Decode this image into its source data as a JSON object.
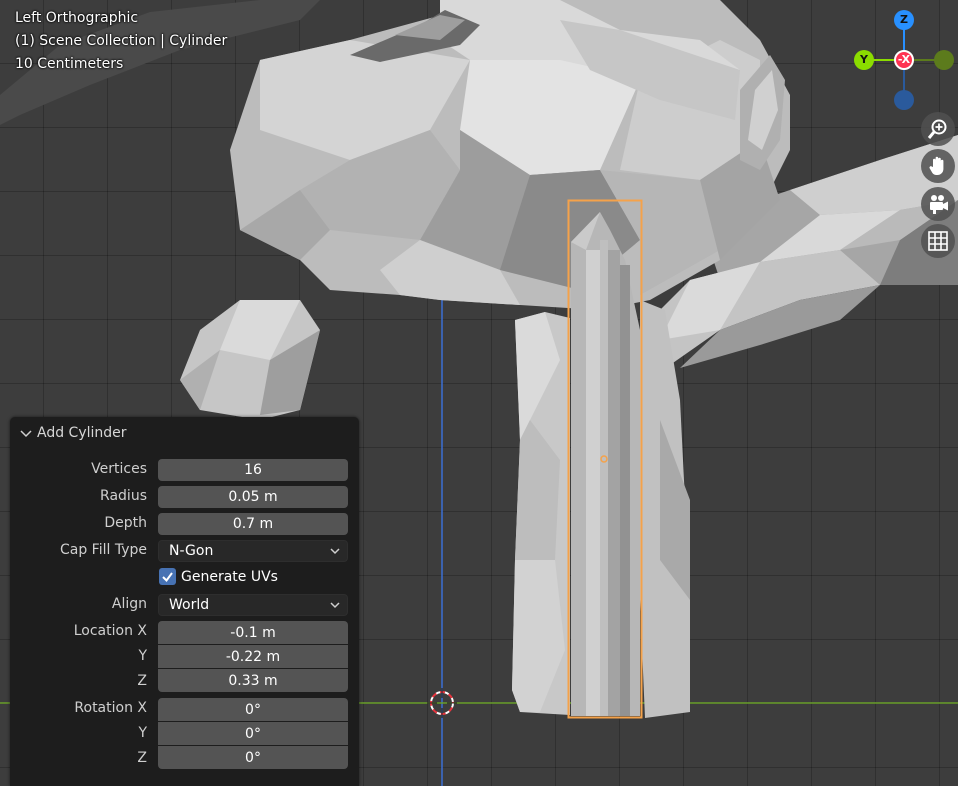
{
  "viewport": {
    "view_name": "Left Orthographic",
    "collection_info": "(1) Scene Collection | Cylinder",
    "scale_info": "10 Centimeters"
  },
  "gizmo": {
    "axis_z": "Z",
    "axis_y": "Y",
    "axis_x": "-X",
    "colors": {
      "x": "#ff3352",
      "y": "#8bdc00",
      "z": "#2890ff",
      "neg_y": "#5c7b1c",
      "neg_z": "#2a5a9c"
    }
  },
  "nav_buttons": [
    "zoom-icon",
    "hand-pan-icon",
    "camera-icon",
    "grid-icon"
  ],
  "operator_panel": {
    "title": "Add Cylinder",
    "vertices_label": "Vertices",
    "vertices_value": "16",
    "radius_label": "Radius",
    "radius_value": "0.05 m",
    "depth_label": "Depth",
    "depth_value": "0.7 m",
    "cap_fill_label": "Cap Fill Type",
    "cap_fill_value": "N-Gon",
    "generate_uvs_label": "Generate UVs",
    "generate_uvs_checked": true,
    "align_label": "Align",
    "align_value": "World",
    "location_label": "Location X",
    "location_y_label": "Y",
    "location_z_label": "Z",
    "location_x": "-0.1 m",
    "location_y": "-0.22 m",
    "location_z": "0.33 m",
    "rotation_label": "Rotation X",
    "rotation_y_label": "Y",
    "rotation_z_label": "Z",
    "rotation_x": "0°",
    "rotation_y": "0°",
    "rotation_z": "0°"
  },
  "colors": {
    "selection_outline": "#f5a24a",
    "checkbox_accent": "#4772b3",
    "z_axis_line": "#3b6fd4",
    "y_axis_line": "#6aa02b"
  }
}
